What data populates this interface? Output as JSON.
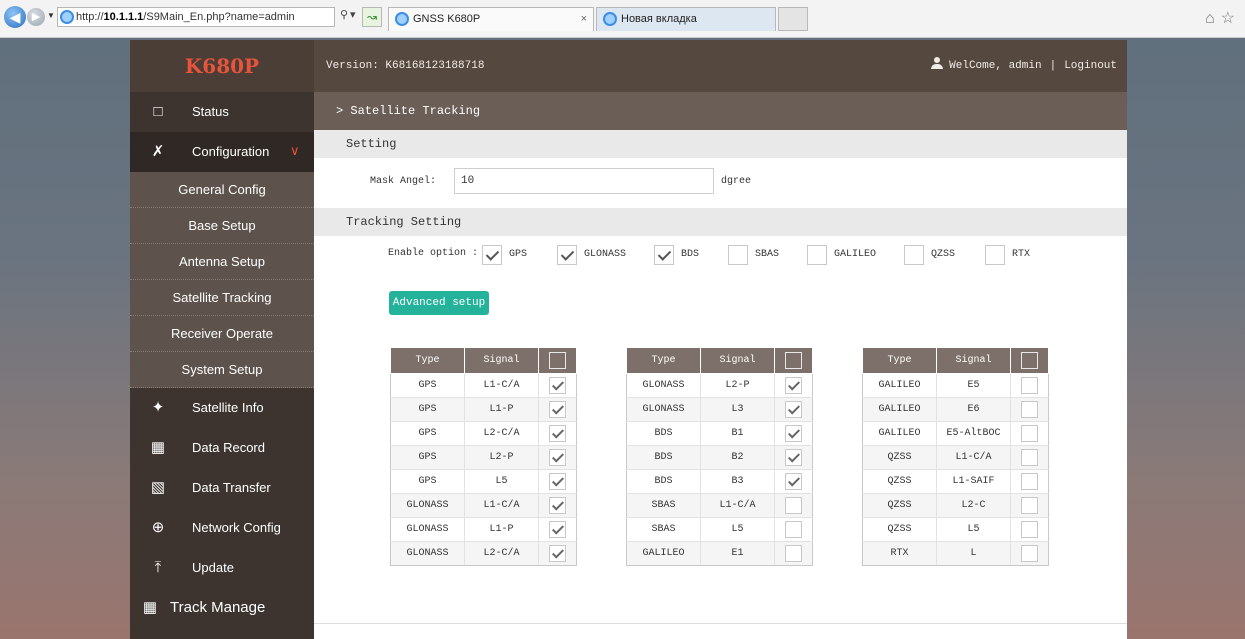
{
  "browser": {
    "address_prefix": "http://",
    "address_host": "10.1.1.1",
    "address_path": "/S9Main_En.php?name=admin",
    "tabs": [
      {
        "label": "GNSS K680P",
        "close": "×"
      },
      {
        "label": "Новая вкладка"
      }
    ]
  },
  "header": {
    "logo": "K680P",
    "version": "Version: K68168123188718",
    "welcome": "WelCome, admin",
    "separator": "|",
    "logout": "Loginout"
  },
  "sidebar": {
    "items": [
      {
        "label": "Status",
        "icon": "monitor-icon"
      },
      {
        "label": "Configuration",
        "icon": "tools-icon"
      }
    ],
    "config_sub": [
      {
        "label": "General Config"
      },
      {
        "label": "Base Setup"
      },
      {
        "label": "Antenna Setup"
      },
      {
        "label": "Satellite Tracking"
      },
      {
        "label": "Receiver Operate"
      },
      {
        "label": "System Setup"
      }
    ],
    "lower": [
      {
        "label": "Satellite Info",
        "icon": "satellite-icon"
      },
      {
        "label": "Data Record",
        "icon": "calendar-icon"
      },
      {
        "label": "Data Transfer",
        "icon": "transfer-icon"
      },
      {
        "label": "Network Config",
        "icon": "globe-icon"
      },
      {
        "label": "Update",
        "icon": "upload-icon"
      },
      {
        "label": "Track Manage",
        "icon": "calendar-icon"
      }
    ]
  },
  "breadcrumb": "> Satellite Tracking",
  "setting": {
    "title": "Setting",
    "mask_label": "Mask Angel:",
    "mask_value": "10",
    "mask_unit": "dgree"
  },
  "tracking": {
    "title": "Tracking Setting",
    "enable_label": "Enable option :",
    "options": [
      {
        "label": "GPS",
        "checked": true
      },
      {
        "label": "GLONASS",
        "checked": true
      },
      {
        "label": "BDS",
        "checked": true
      },
      {
        "label": "SBAS",
        "checked": false
      },
      {
        "label": "GALILEO",
        "checked": false
      },
      {
        "label": "QZSS",
        "checked": false
      },
      {
        "label": "RTX",
        "checked": false
      }
    ],
    "advanced_label": "Advanced setup"
  },
  "signal_tables": [
    {
      "headers": [
        "Type",
        "Signal"
      ],
      "rows": [
        {
          "type": "GPS",
          "signal": "L1-C/A",
          "checked": true
        },
        {
          "type": "GPS",
          "signal": "L1-P",
          "checked": true
        },
        {
          "type": "GPS",
          "signal": "L2-C/A",
          "checked": true
        },
        {
          "type": "GPS",
          "signal": "L2-P",
          "checked": true
        },
        {
          "type": "GPS",
          "signal": "L5",
          "checked": true
        },
        {
          "type": "GLONASS",
          "signal": "L1-C/A",
          "checked": true
        },
        {
          "type": "GLONASS",
          "signal": "L1-P",
          "checked": true
        },
        {
          "type": "GLONASS",
          "signal": "L2-C/A",
          "checked": true
        }
      ]
    },
    {
      "headers": [
        "Type",
        "Signal"
      ],
      "rows": [
        {
          "type": "GLONASS",
          "signal": "L2-P",
          "checked": true
        },
        {
          "type": "GLONASS",
          "signal": "L3",
          "checked": true
        },
        {
          "type": "BDS",
          "signal": "B1",
          "checked": true
        },
        {
          "type": "BDS",
          "signal": "B2",
          "checked": true
        },
        {
          "type": "BDS",
          "signal": "B3",
          "checked": true
        },
        {
          "type": "SBAS",
          "signal": "L1-C/A",
          "checked": false
        },
        {
          "type": "SBAS",
          "signal": "L5",
          "checked": false
        },
        {
          "type": "GALILEO",
          "signal": "E1",
          "checked": false
        }
      ]
    },
    {
      "headers": [
        "Type",
        "Signal"
      ],
      "rows": [
        {
          "type": "GALILEO",
          "signal": "E5",
          "checked": false
        },
        {
          "type": "GALILEO",
          "signal": "E6",
          "checked": false
        },
        {
          "type": "GALILEO",
          "signal": "E5-AltBOC",
          "checked": false
        },
        {
          "type": "QZSS",
          "signal": "L1-C/A",
          "checked": false
        },
        {
          "type": "QZSS",
          "signal": "L1-SAIF",
          "checked": false
        },
        {
          "type": "QZSS",
          "signal": "L2-C",
          "checked": false
        },
        {
          "type": "QZSS",
          "signal": "L5",
          "checked": false
        },
        {
          "type": "RTX",
          "signal": "L",
          "checked": false
        }
      ]
    }
  ]
}
